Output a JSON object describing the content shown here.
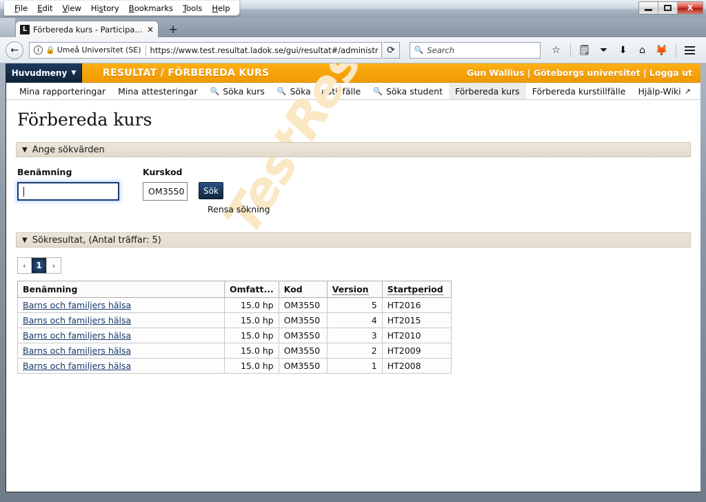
{
  "os": {
    "menus": [
      "File",
      "Edit",
      "View",
      "History",
      "Bookmarks",
      "Tools",
      "Help"
    ],
    "window_controls": {
      "minimize": "minimize-button",
      "maximize": "maximize-button",
      "close": "X"
    }
  },
  "browser": {
    "tab": {
      "favicon_letter": "L",
      "title": "Förbereda kurs - Participati...",
      "close_glyph": "✕"
    },
    "new_tab_glyph": "+",
    "back_glyph": "←",
    "identity": "Umeå Universitet (SE)",
    "url": "https://www.test.resultat.ladok.se/gui/resultat#/administr",
    "reload_glyph": "⟳",
    "search": {
      "placeholder": "Search",
      "icon": "search-icon"
    },
    "toolbar_icons": [
      "bookmark-star-icon",
      "reader-list-icon",
      "pocket-icon",
      "downloads-icon",
      "home-icon",
      "firefox-account-icon",
      "hamburger-menu-icon"
    ]
  },
  "app": {
    "main_menu_label": "Huvudmeny",
    "main_menu_chevron": "▼",
    "header_title": "RESULTAT / FÖRBEREDA KURS",
    "user_name": "Gun Wallius",
    "organisation": "Göteborgs universitet",
    "logout_label": "Logga ut",
    "separator": "|",
    "nav_tabs": [
      {
        "label": "Mina rapporteringar",
        "icon": "",
        "active": false
      },
      {
        "label": "Mina attesteringar",
        "icon": "",
        "active": false
      },
      {
        "label": "Söka kurs",
        "icon": "search-icon",
        "active": false
      },
      {
        "label": "Söka kurstillfälle",
        "icon": "search-icon",
        "active": false
      },
      {
        "label": "Söka student",
        "icon": "search-icon",
        "active": false
      },
      {
        "label": "Förbereda kurs",
        "icon": "",
        "active": true
      },
      {
        "label": "Förbereda kurstillfälle",
        "icon": "",
        "active": false
      },
      {
        "label": "Hjälp-Wiki",
        "icon": "external-link-icon",
        "active": false
      }
    ]
  },
  "page": {
    "title": "Förbereda kurs",
    "watermark": "TestResultat",
    "search_panel": {
      "header": "Ange sökvärden",
      "chevron": "▼",
      "benamning_label": "Benämning",
      "benamning_value": "",
      "kurskod_label": "Kurskod",
      "kurskod_value": "OM3550",
      "search_button": "Sök",
      "clear_link": "Rensa sökning"
    },
    "results_panel": {
      "header": "Sökresultat, (Antal träffar: 5)",
      "chevron": "▼",
      "hit_count": 5,
      "pagination": {
        "prev": "‹",
        "pages": [
          "1"
        ],
        "current": "1",
        "next": "›"
      },
      "columns": [
        "Benämning",
        "Omfatt...",
        "Kod",
        "Version",
        "Startperiod"
      ],
      "rows": [
        {
          "benamning": "Barns och familjers hälsa",
          "omfattning": "15.0 hp",
          "kod": "OM3550",
          "version": "5",
          "startperiod": "HT2016"
        },
        {
          "benamning": "Barns och familjers hälsa",
          "omfattning": "15.0 hp",
          "kod": "OM3550",
          "version": "4",
          "startperiod": "HT2015"
        },
        {
          "benamning": "Barns och familjers hälsa",
          "omfattning": "15.0 hp",
          "kod": "OM3550",
          "version": "3",
          "startperiod": "HT2010"
        },
        {
          "benamning": "Barns och familjers hälsa",
          "omfattning": "15.0 hp",
          "kod": "OM3550",
          "version": "2",
          "startperiod": "HT2009"
        },
        {
          "benamning": "Barns och familjers hälsa",
          "omfattning": "15.0 hp",
          "kod": "OM3550",
          "version": "1",
          "startperiod": "HT2008"
        }
      ]
    }
  },
  "colors": {
    "brand_orange": "#f7a30a",
    "brand_navy": "#16314f",
    "panel_beige": "#e8e1d3",
    "link_blue": "#15396b",
    "watermark": "#fae7c4"
  }
}
